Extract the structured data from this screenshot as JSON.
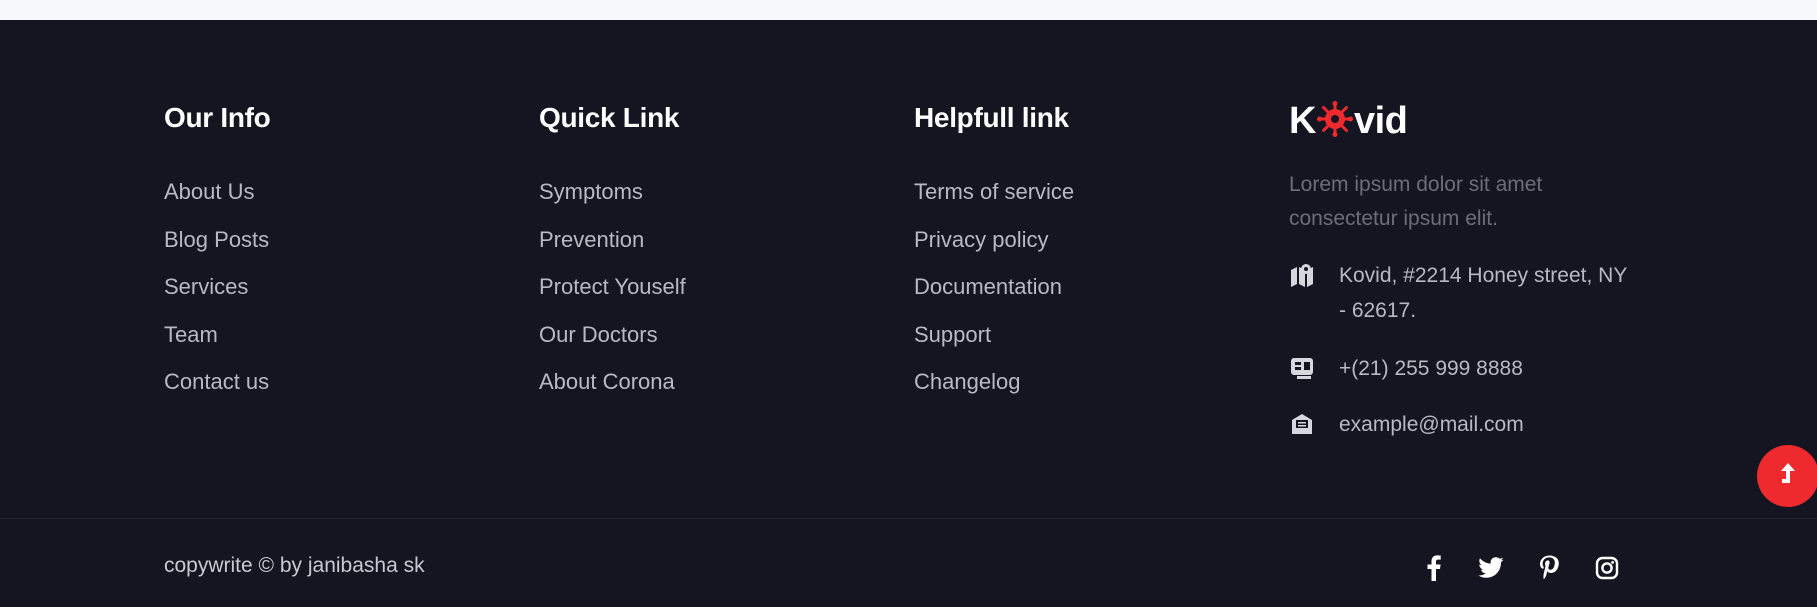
{
  "footer": {
    "our_info": {
      "title": "Our Info",
      "links": [
        "About Us",
        "Blog Posts",
        "Services",
        "Team",
        "Contact us"
      ]
    },
    "quick_link": {
      "title": "Quick Link",
      "links": [
        "Symptoms",
        "Prevention",
        "Protect Youself",
        "Our Doctors",
        "About Corona"
      ]
    },
    "helpful_link": {
      "title": "Helpfull link",
      "links": [
        "Terms of service",
        "Privacy policy",
        "Documentation",
        "Support",
        "Changelog"
      ]
    },
    "brand": {
      "logo_prefix": "K",
      "logo_suffix": "vid",
      "description": "Lorem ipsum dolor sit amet consectetur ipsum elit.",
      "address": "Kovid, #2214 Honey street, NY - 62617.",
      "phone": "+(21) 255 999 8888",
      "email": "example@mail.com",
      "icons": {
        "address": "map-icon",
        "phone": "phone-icon",
        "email": "mail-icon"
      }
    },
    "copyright": "copywrite © by janibasha sk",
    "social": [
      "facebook-icon",
      "twitter-icon",
      "pinterest-icon",
      "instagram-icon"
    ]
  },
  "colors": {
    "background": "#151521",
    "accent": "#ee2a2f",
    "link": "#b9b9c4",
    "muted": "#6c6c7a"
  }
}
